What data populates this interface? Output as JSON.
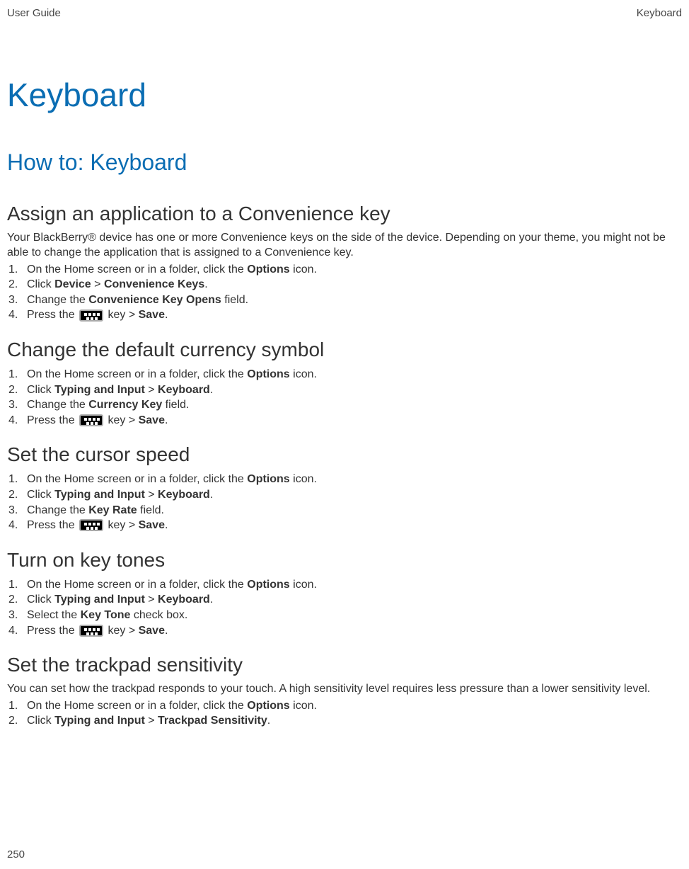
{
  "header": {
    "left": "User Guide",
    "right": "Keyboard"
  },
  "h1": "Keyboard",
  "h2": "How to: Keyboard",
  "sections": [
    {
      "title": "Assign an application to a Convenience key",
      "intro": "Your BlackBerry® device has one or more Convenience keys on the side of the device. Depending on your theme, you might not be able to change the application that is assigned to a Convenience key.",
      "steps": [
        {
          "pre": "On the Home screen or in a folder, click the ",
          "b1": "Options",
          "post": " icon."
        },
        {
          "pre": "Click ",
          "b1": "Device",
          "mid": " > ",
          "b2": "Convenience Keys",
          "post": "."
        },
        {
          "pre": "Change the ",
          "b1": "Convenience Key Opens",
          "post": " field."
        },
        {
          "press": true,
          "b1": "Save"
        }
      ]
    },
    {
      "title": "Change the default currency symbol",
      "steps": [
        {
          "pre": "On the Home screen or in a folder, click the ",
          "b1": "Options",
          "post": " icon."
        },
        {
          "pre": "Click ",
          "b1": "Typing and Input",
          "mid": " > ",
          "b2": "Keyboard",
          "post": "."
        },
        {
          "pre": "Change the ",
          "b1": "Currency Key",
          "post": " field."
        },
        {
          "press": true,
          "b1": "Save"
        }
      ]
    },
    {
      "title": "Set the cursor speed",
      "steps": [
        {
          "pre": "On the Home screen or in a folder, click the ",
          "b1": "Options",
          "post": " icon."
        },
        {
          "pre": "Click ",
          "b1": "Typing and Input",
          "mid": " > ",
          "b2": "Keyboard",
          "post": "."
        },
        {
          "pre": "Change the ",
          "b1": "Key Rate",
          "post": " field."
        },
        {
          "press": true,
          "b1": "Save"
        }
      ]
    },
    {
      "title": "Turn on key tones",
      "steps": [
        {
          "pre": "On the Home screen or in a folder, click the ",
          "b1": "Options",
          "post": " icon."
        },
        {
          "pre": "Click ",
          "b1": "Typing and Input",
          "mid": " > ",
          "b2": "Keyboard",
          "post": "."
        },
        {
          "pre": "Select the ",
          "b1": "Key Tone",
          "post": " check box."
        },
        {
          "press": true,
          "b1": "Save"
        }
      ]
    },
    {
      "title": "Set the trackpad sensitivity",
      "intro": "You can set how the trackpad responds to your touch. A high sensitivity level requires less pressure than a lower sensitivity level.",
      "steps": [
        {
          "pre": "On the Home screen or in a folder, click the ",
          "b1": "Options",
          "post": " icon."
        },
        {
          "pre": "Click ",
          "b1": "Typing and Input",
          "mid": " > ",
          "b2": "Trackpad Sensitivity",
          "post": "."
        }
      ]
    }
  ],
  "strings": {
    "press_pre": "Press the ",
    "press_mid": " key > "
  },
  "page_number": "250"
}
